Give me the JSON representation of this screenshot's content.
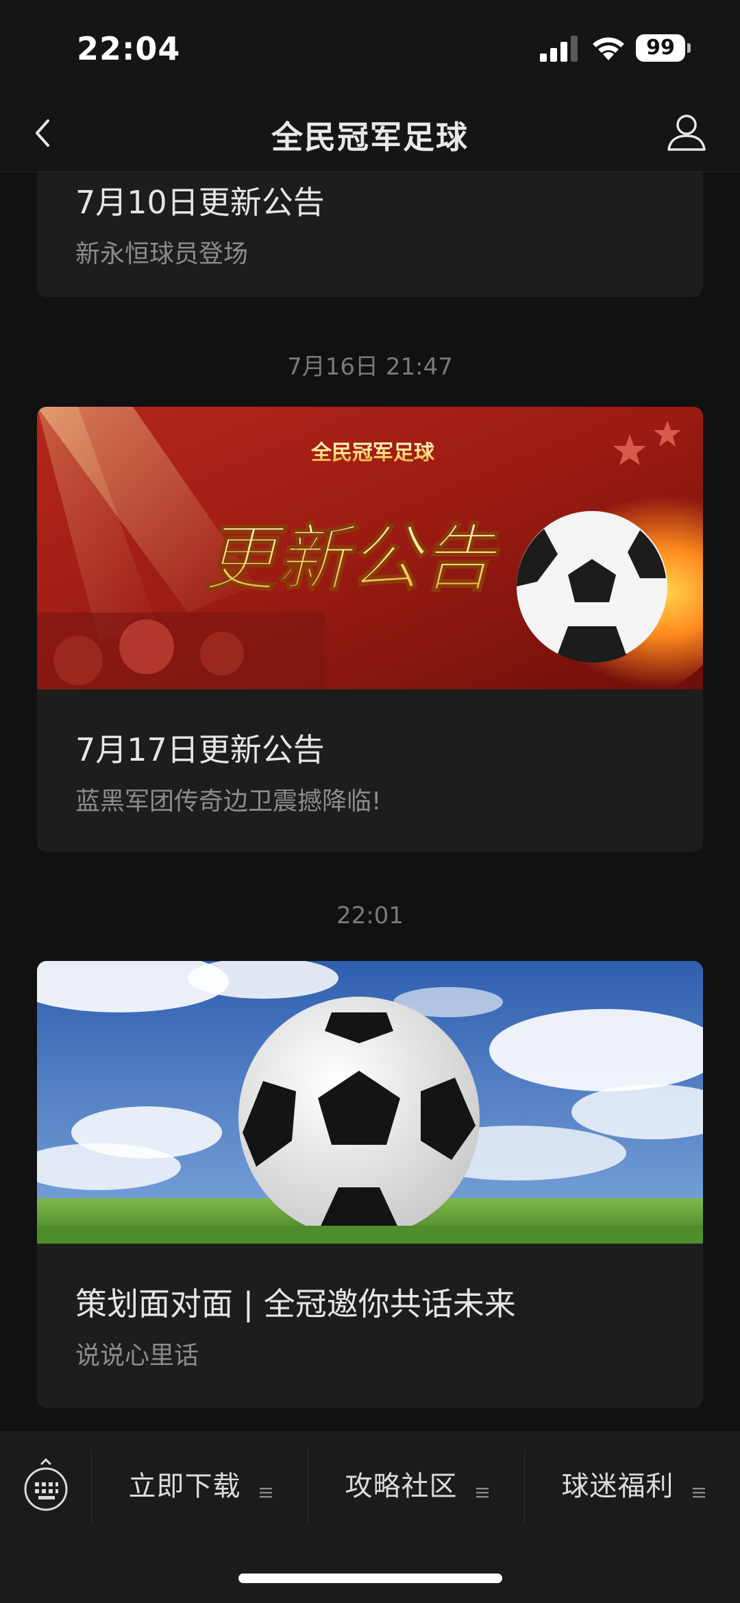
{
  "status_bar": {
    "time": "22:04",
    "battery": "99"
  },
  "nav": {
    "title": "全民冠军足球"
  },
  "messages": [
    {
      "title": "7月10日更新公告",
      "subtitle": "新永恒球员登场"
    },
    {
      "timestamp": "7月16日 21:47",
      "banner_logo": "全民冠军足球",
      "banner_headline": "更新公告",
      "title": "7月17日更新公告",
      "subtitle": "蓝黑军团传奇边卫震撼降临!"
    },
    {
      "timestamp": "22:01",
      "title": "策划面对面 | 全冠邀你共话未来",
      "subtitle": "说说心里话"
    }
  ],
  "bottom_menu": {
    "items": [
      {
        "label": "立即下载"
      },
      {
        "label": "攻略社区"
      },
      {
        "label": "球迷福利"
      }
    ]
  },
  "icons": {
    "back": "chevron-left-icon",
    "profile": "person-icon",
    "keyboard": "keyboard-icon",
    "menu": "menu-lines-icon"
  },
  "colors": {
    "background": "#111111",
    "card": "#1d1d1d",
    "text_primary": "#e6e6e6",
    "text_secondary": "#8c8c8c"
  }
}
